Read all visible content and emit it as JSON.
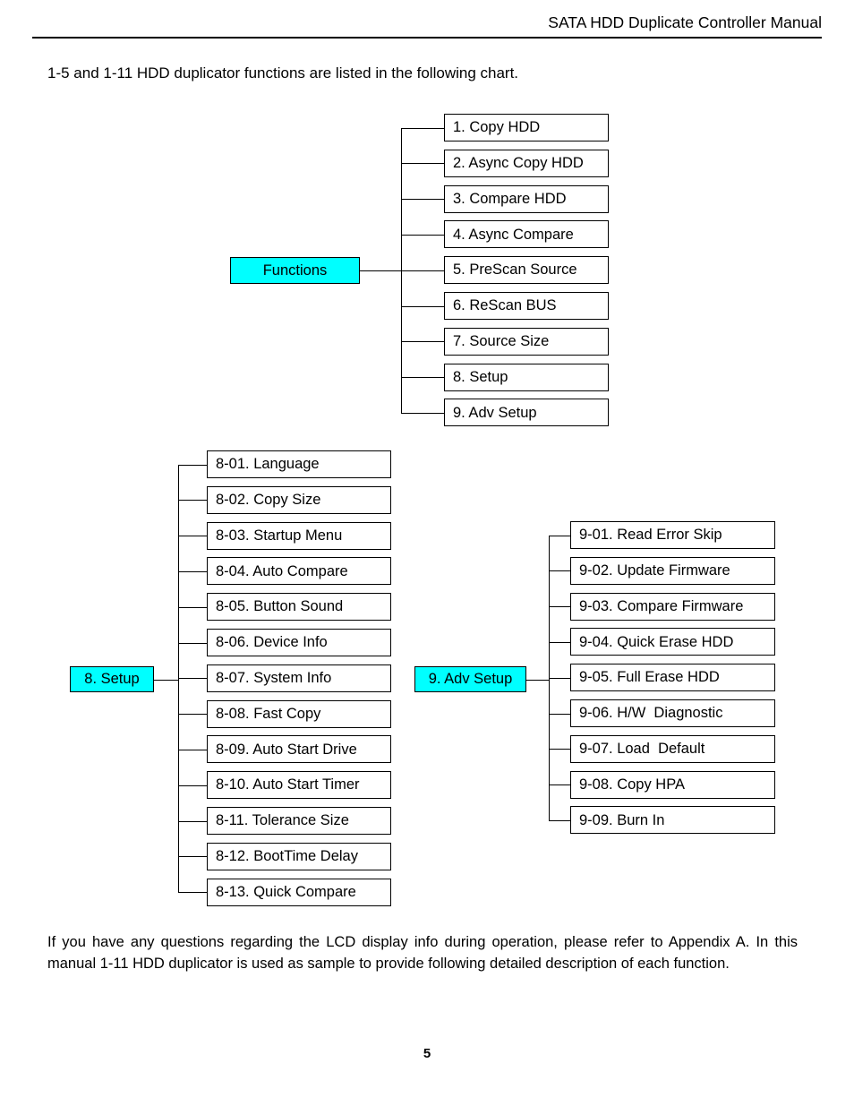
{
  "header": {
    "title": "SATA HDD Duplicate Controller Manual"
  },
  "intro": {
    "text": "1-5 and 1-11 HDD duplicator functions are listed in the following chart."
  },
  "footer": {
    "text": "If you have any questions regarding the LCD display info during operation, please refer to Appendix A. In this manual 1-11 HDD duplicator is used as sample to provide following detailed description of each function.",
    "page_number": "5"
  },
  "colors": {
    "root_fill": "#00ffff",
    "line": "#000000",
    "box_fill": "#ffffff"
  },
  "chart_data": {
    "type": "diagram",
    "title": "HDD duplicator function menu tree",
    "branches": [
      {
        "id": "functions",
        "root_label": "Functions",
        "root_highlight": "#00ffff",
        "children": [
          "1. Copy HDD",
          "2. Async Copy HDD",
          "3. Compare HDD",
          "4. Async Compare",
          "5. PreScan Source",
          "6. ReScan BUS",
          "7. Source Size",
          "8. Setup",
          "9. Adv Setup"
        ]
      },
      {
        "id": "setup",
        "root_label": "8. Setup",
        "root_highlight": "#00ffff",
        "children": [
          "8-01. Language",
          "8-02. Copy Size",
          "8-03. Startup Menu",
          "8-04. Auto Compare",
          "8-05. Button Sound",
          "8-06. Device Info",
          "8-07. System Info",
          "8-08. Fast Copy",
          "8-09. Auto Start Drive",
          "8-10. Auto Start Timer",
          "8-11. Tolerance Size",
          "8-12. BootTime Delay",
          "8-13. Quick Compare"
        ]
      },
      {
        "id": "adv_setup",
        "root_label": "9. Adv Setup",
        "root_highlight": "#00ffff",
        "children": [
          "9-01. Read Error Skip",
          "9-02. Update Firmware",
          "9-03. Compare Firmware",
          "9-04. Quick Erase HDD",
          "9-05. Full Erase HDD",
          "9-06. H/W  Diagnostic",
          "9-07. Load  Default",
          "9-08. Copy HPA",
          "9-09. Burn In"
        ]
      }
    ]
  }
}
